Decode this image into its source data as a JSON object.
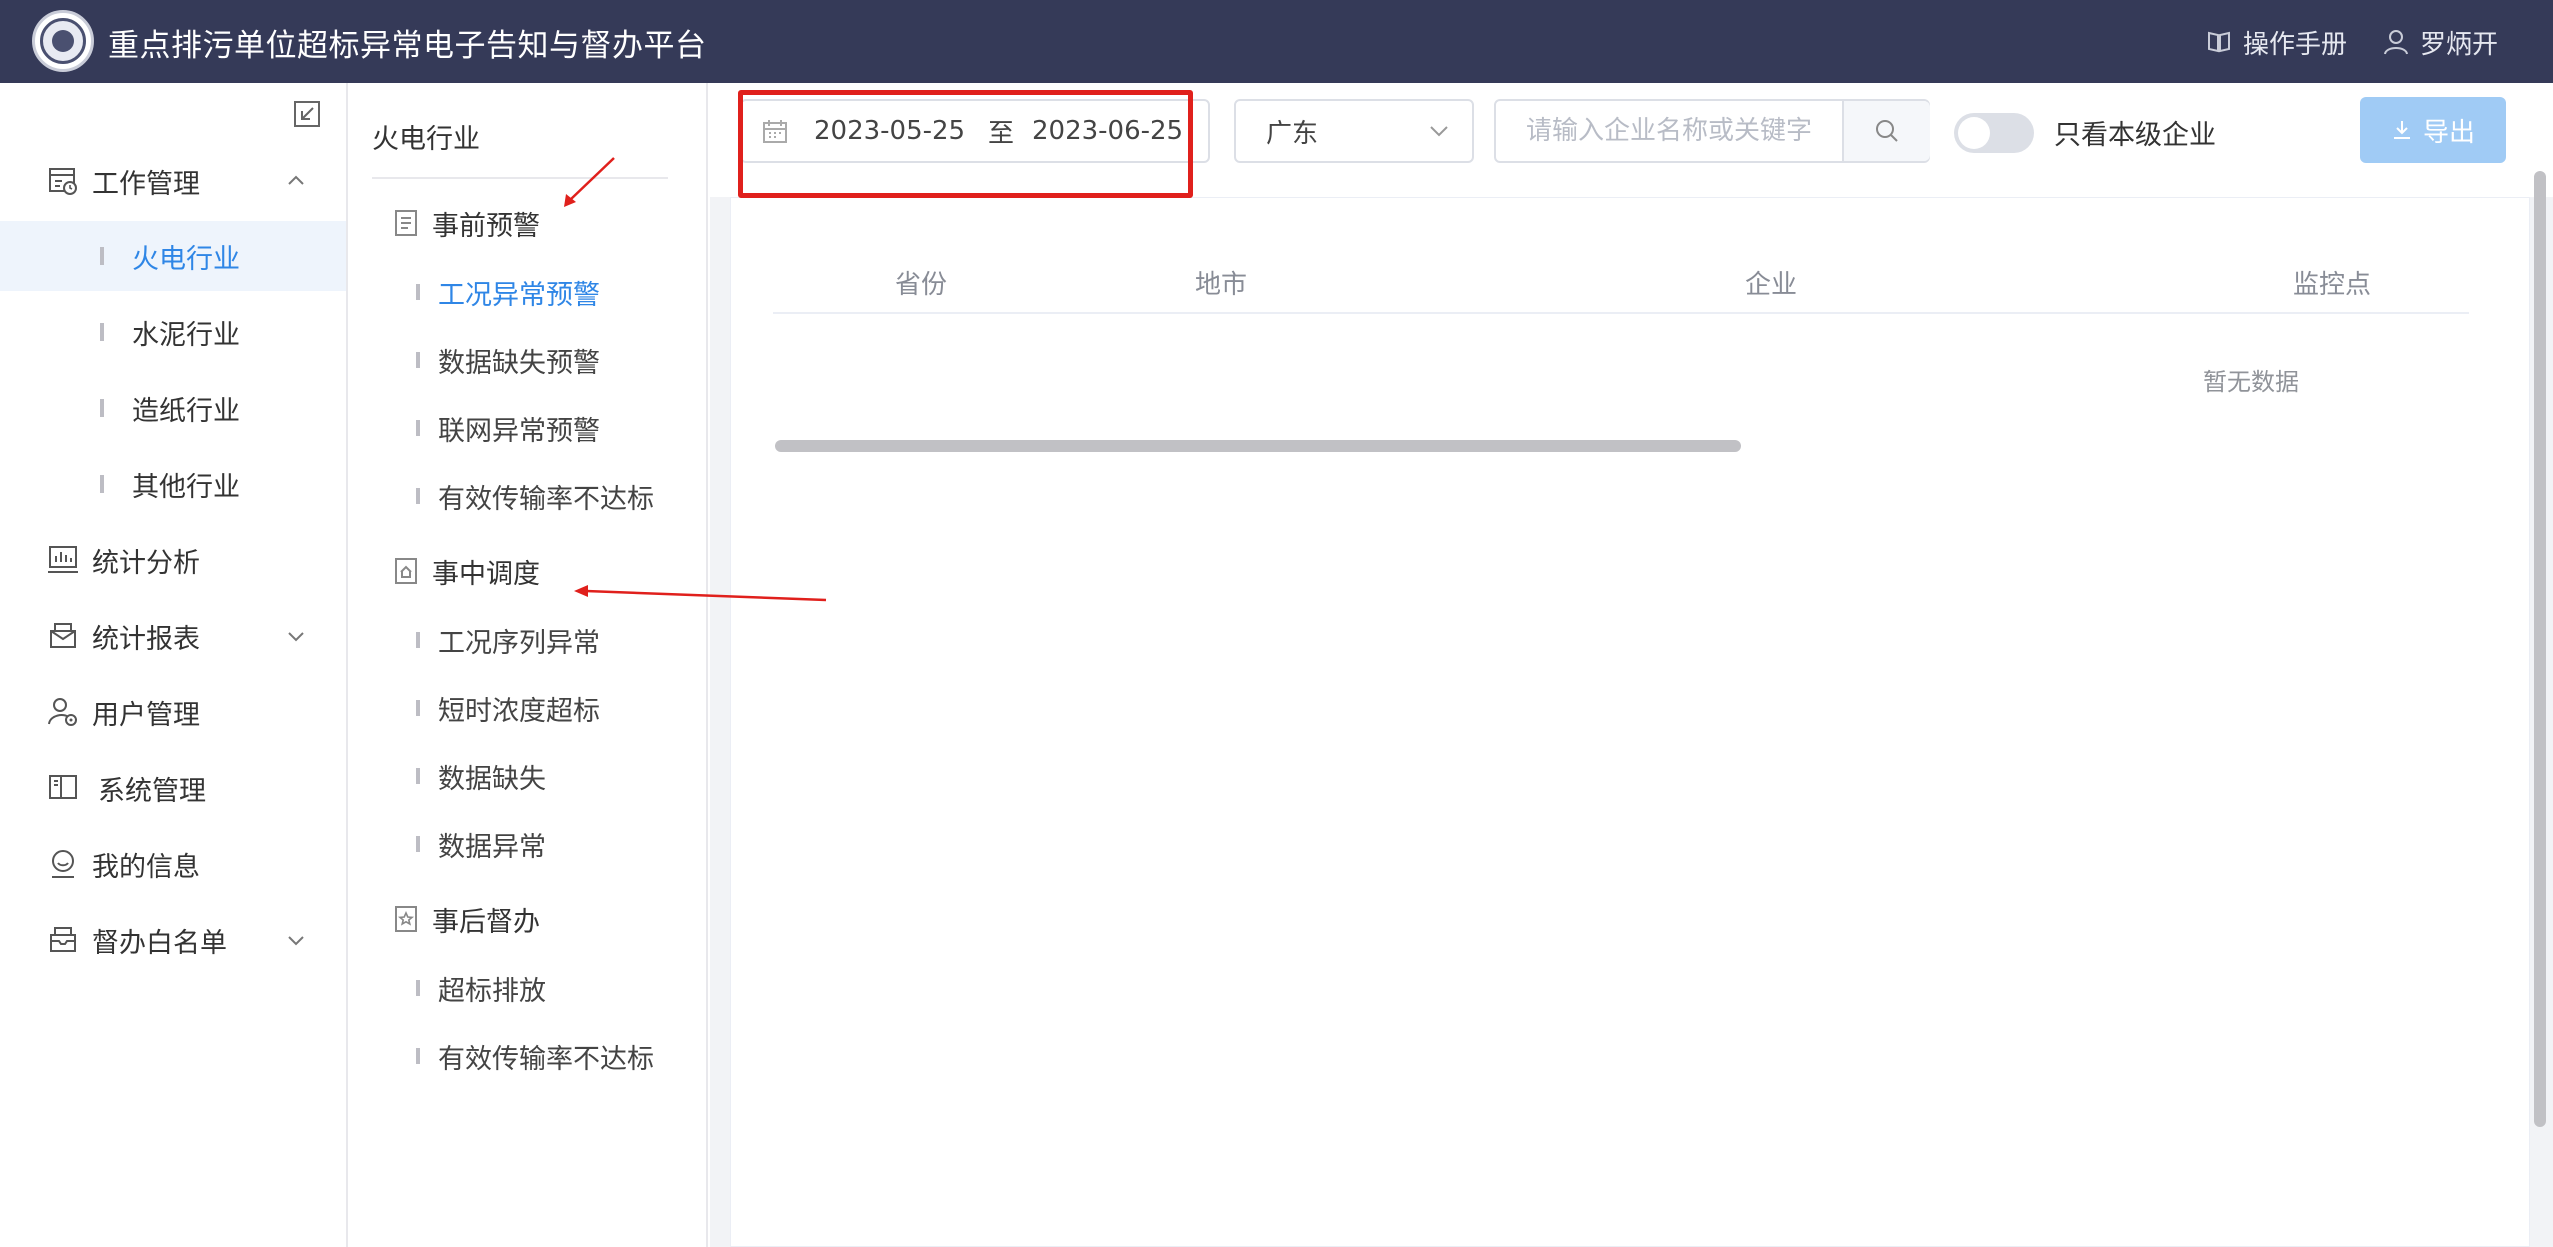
{
  "header": {
    "title": "重点排污单位超标异常电子告知与督办平台",
    "manual_label": "操作手册",
    "user_name": "罗炳开"
  },
  "sidebar": {
    "items": [
      {
        "label": "工作管理",
        "icon": "work-icon",
        "expanded": true
      },
      {
        "label": "统计分析",
        "icon": "chart-icon"
      },
      {
        "label": "统计报表",
        "icon": "report-icon",
        "expandable": true
      },
      {
        "label": "用户管理",
        "icon": "user-gear-icon"
      },
      {
        "label": "系统管理",
        "icon": "book-icon"
      },
      {
        "label": "我的信息",
        "icon": "profile-icon"
      },
      {
        "label": "督办白名单",
        "icon": "inbox-icon",
        "expandable": true
      }
    ],
    "sub_items": [
      {
        "label": "火电行业",
        "active": true
      },
      {
        "label": "水泥行业"
      },
      {
        "label": "造纸行业"
      },
      {
        "label": "其他行业"
      }
    ]
  },
  "panel2": {
    "title": "火电行业",
    "groups": [
      {
        "label": "事前预警",
        "icon": "document-icon",
        "items": [
          "工况异常预警",
          "数据缺失预警",
          "联网异常预警",
          "有效传输率不达标"
        ]
      },
      {
        "label": "事中调度",
        "icon": "home-doc-icon",
        "items": [
          "工况序列异常",
          "短时浓度超标",
          "数据缺失",
          "数据异常"
        ]
      },
      {
        "label": "事后督办",
        "icon": "star-doc-icon",
        "items": [
          "超标排放",
          "有效传输率不达标"
        ]
      }
    ],
    "active_item": "工况异常预警"
  },
  "toolbar": {
    "date_start": "2023-05-25",
    "date_sep": "至",
    "date_end": "2023-06-25",
    "region": "广东",
    "search_placeholder": "请输入企业名称或关键字",
    "toggle_label": "只看本级企业",
    "toggle_on": false,
    "export_label": "导出"
  },
  "table": {
    "columns": [
      "省份",
      "地市",
      "企业",
      "监控点"
    ],
    "empty_text": "暂无数据"
  },
  "colors": {
    "header_bg": "#353a58",
    "accent": "#2f86e6",
    "annotation_red": "#e0201c"
  }
}
